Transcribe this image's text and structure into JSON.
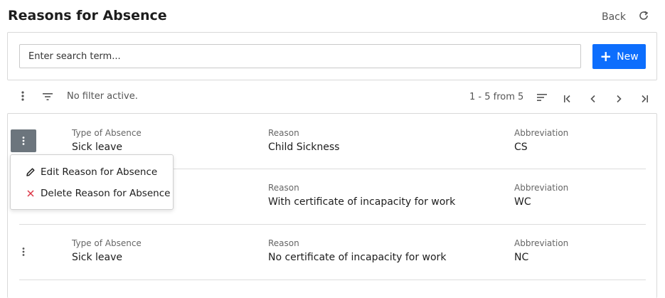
{
  "header": {
    "title": "Reasons for Absence",
    "back_label": "Back"
  },
  "search": {
    "placeholder": "Enter search term...",
    "value": ""
  },
  "new_button": {
    "label": "New"
  },
  "toolbar": {
    "filter_status": "No filter active.",
    "pagination": "1 - 5 from 5"
  },
  "context_menu": {
    "edit_label": "Edit Reason for Absence",
    "delete_label": "Delete Reason for Absence"
  },
  "columns": {
    "type": "Type of Absence",
    "reason": "Reason",
    "abbreviation": "Abbreviation"
  },
  "rows": [
    {
      "type": "Sick leave",
      "reason": "Child Sickness",
      "abbreviation": "CS"
    },
    {
      "type": "",
      "reason": "With certificate of incapacity for work",
      "abbreviation": "WC"
    },
    {
      "type": "Sick leave",
      "reason": "No certificate of incapacity for work",
      "abbreviation": "NC"
    }
  ],
  "colors": {
    "primary": "#0d6efd",
    "menu_active": "#6c757d",
    "delete_icon": "#dc3545"
  }
}
